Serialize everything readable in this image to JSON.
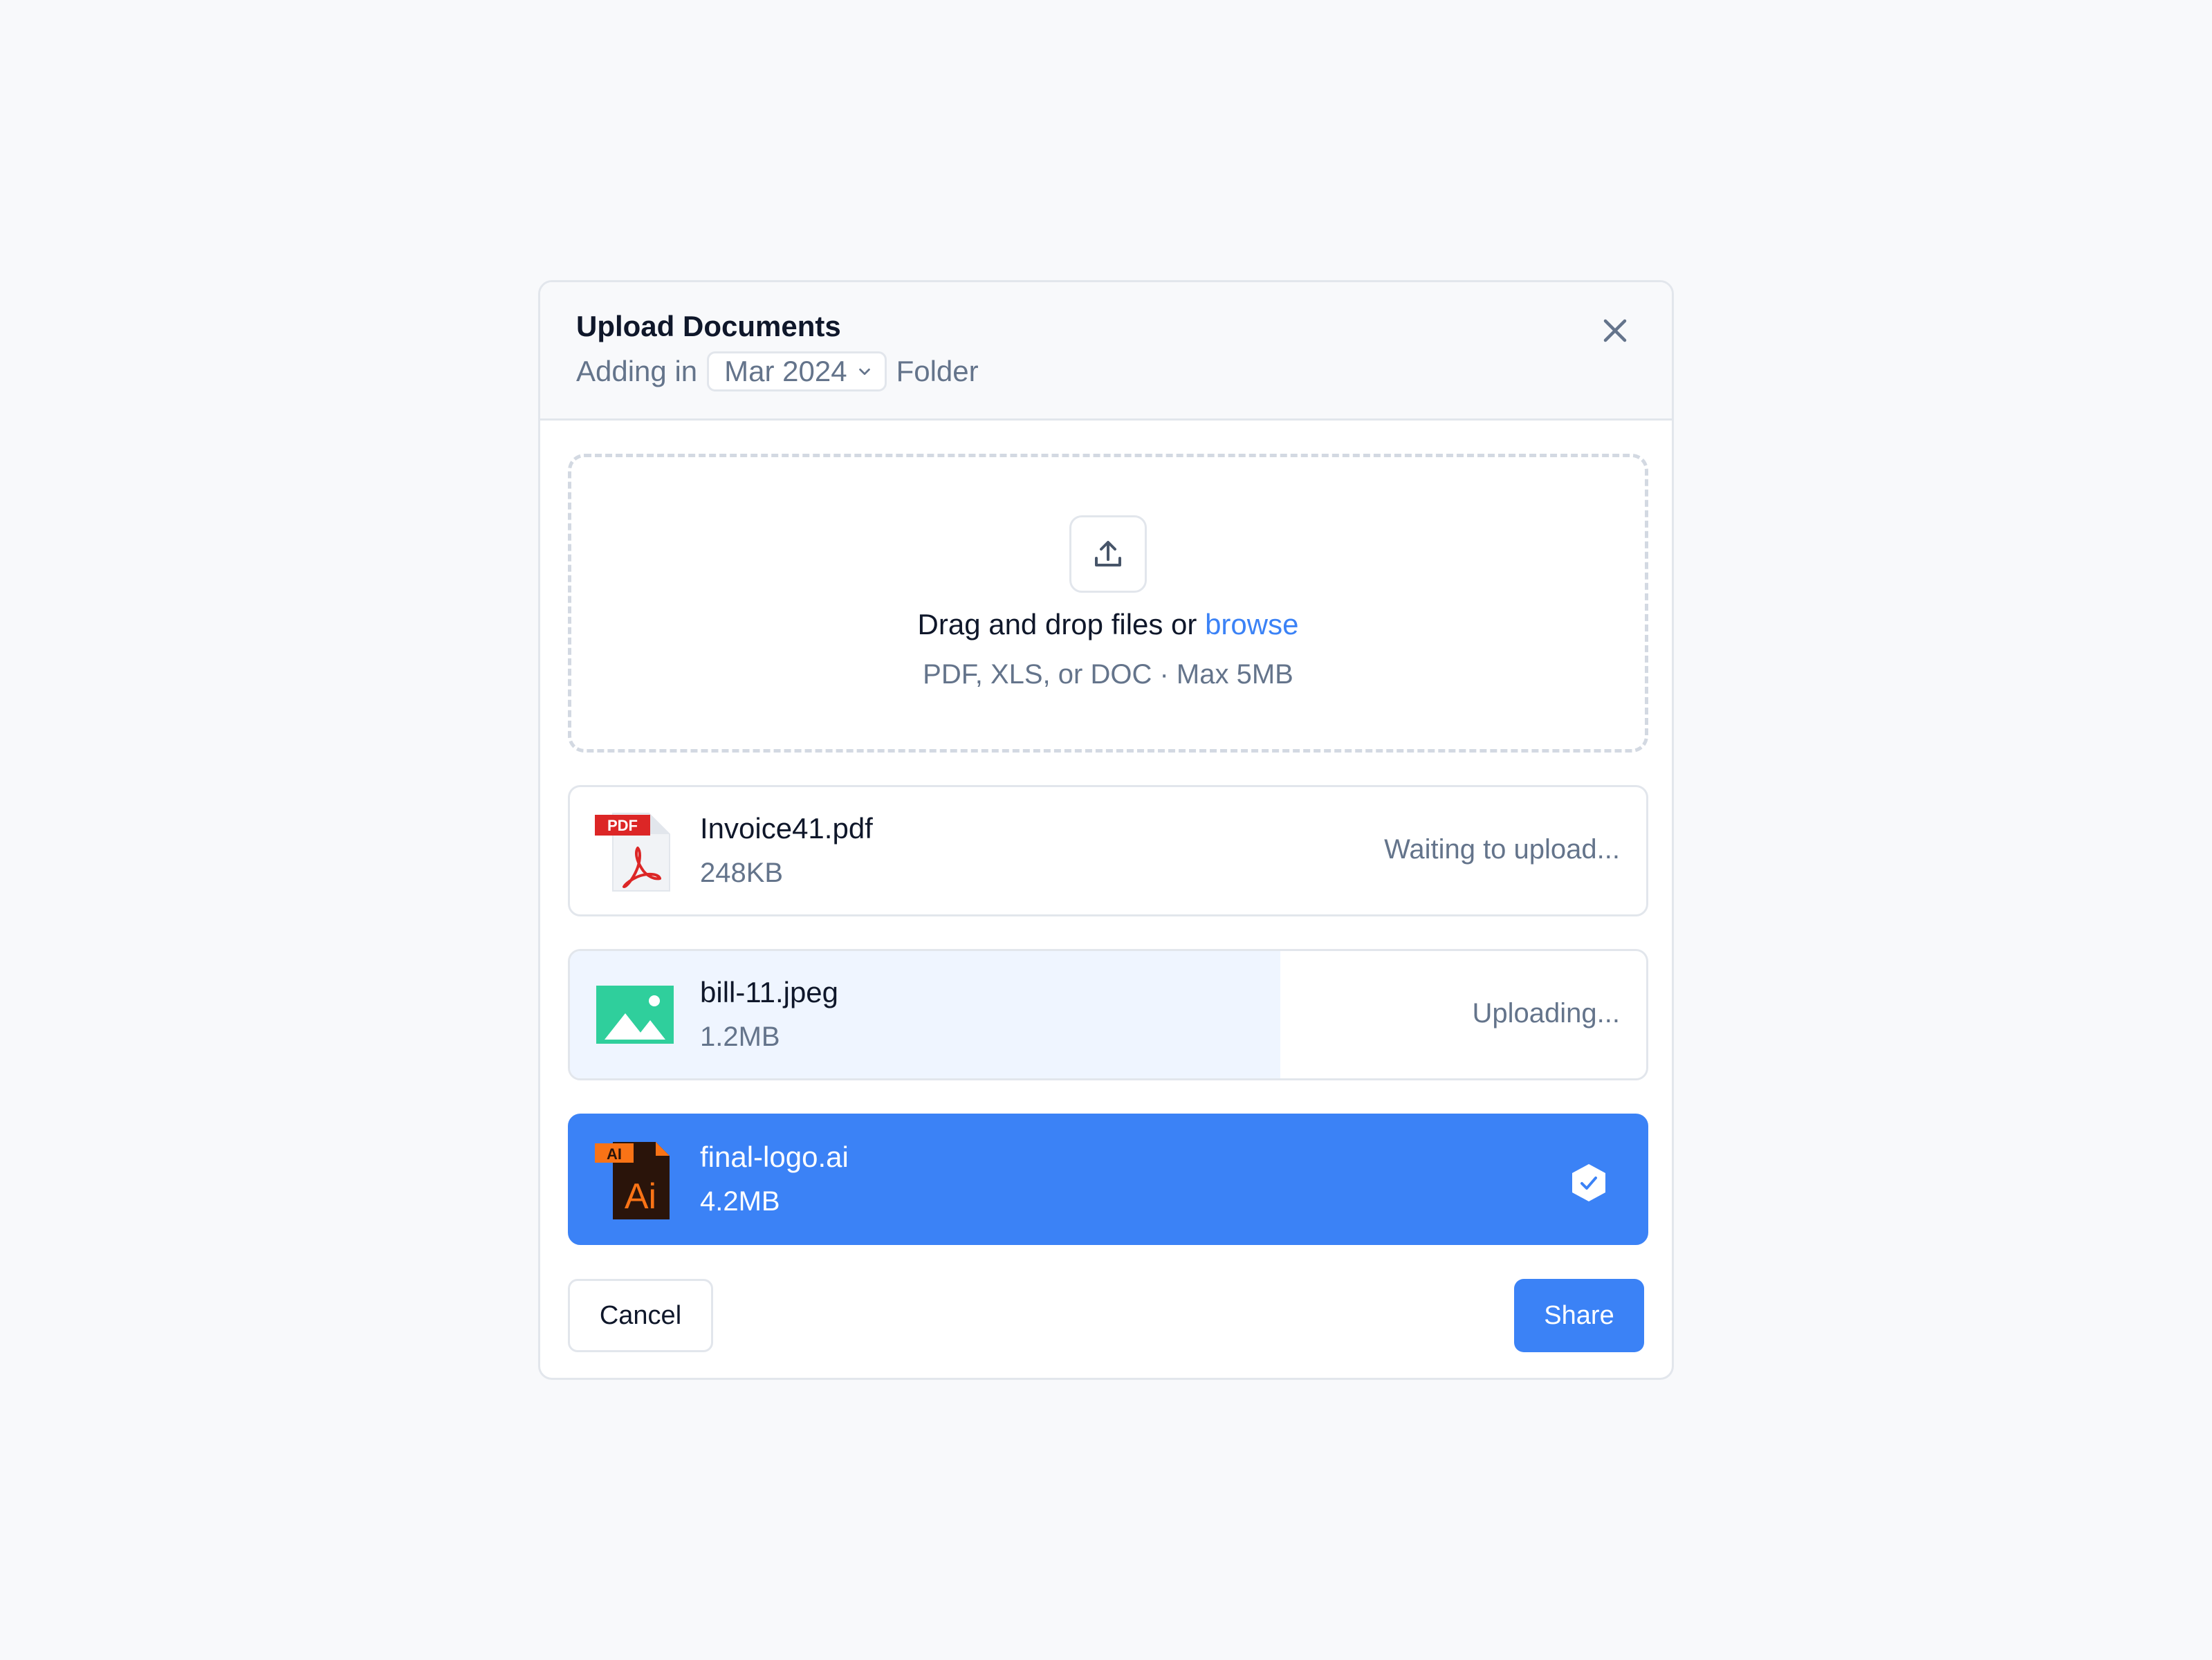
{
  "header": {
    "title": "Upload Documents",
    "subtitle_prefix": "Adding in",
    "folder_selected": "Mar 2024",
    "subtitle_suffix": "Folder",
    "close_icon": "close-icon"
  },
  "dropzone": {
    "icon": "upload-icon",
    "text": "Drag and drop files or",
    "link": "browse",
    "hint": "PDF, XLS, or DOC · Max 5MB"
  },
  "files": [
    {
      "name": "Invoice41.pdf",
      "size": "248KB",
      "status": "Waiting to upload...",
      "icon": "pdf-file-icon",
      "icon_label": "PDF"
    },
    {
      "name": "bill-11.jpeg",
      "size": "1.2MB",
      "status": "Uploading...",
      "icon": "image-file-icon",
      "progress": 0.66
    },
    {
      "name": "final-logo.ai",
      "size": "4.2MB",
      "icon": "illustrator-file-icon",
      "icon_label": "AI",
      "icon_text": "Ai",
      "status_icon": "check-badge-icon"
    }
  ],
  "footer": {
    "cancel_label": "Cancel",
    "share_label": "Share"
  },
  "colors": {
    "accent": "#3b82f6",
    "progress_bg": "#eff5ff",
    "image_icon": "#2fcf9c",
    "pdf_red": "#dc2626",
    "ai_orange": "#f97316",
    "ai_dark": "#2a140a"
  }
}
